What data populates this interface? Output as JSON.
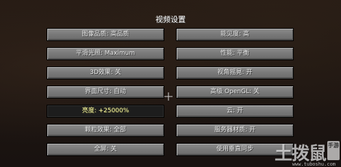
{
  "screen": {
    "title": "视频设置"
  },
  "settings": {
    "left": [
      {
        "label": "图像品质: 高品质"
      },
      {
        "label": "平滑光照: Maximum"
      },
      {
        "label": "3D效果: 关"
      },
      {
        "label": "界面尺寸: 自动"
      },
      {
        "label": "亮度: +25000%",
        "highlighted": true
      },
      {
        "label": "颗粒效果: 全部"
      },
      {
        "label": "全屏: 关"
      }
    ],
    "right": [
      {
        "label": "能见度: 高"
      },
      {
        "label": "性能: 平衡"
      },
      {
        "label": "视角摇晃: 开"
      },
      {
        "label": "高级 OpenGL: 关"
      },
      {
        "label": "云: 开"
      },
      {
        "label": "服务器材质: 开"
      },
      {
        "label": "使用垂直同步"
      }
    ]
  },
  "watermark": {
    "main": "土拨鼠",
    "side": "手游",
    "url": "www.tuboshu.com"
  },
  "colors": {
    "button_face": "#7a7a7a",
    "button_selected": "#1d1d1d",
    "highlight_text": "#ffffa0",
    "text": "#e8e8e8"
  }
}
